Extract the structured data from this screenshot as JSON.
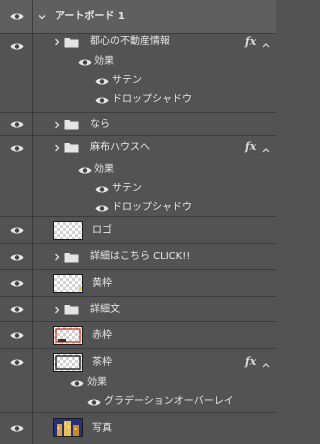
{
  "artboard": {
    "name": "アートボード 1"
  },
  "layers": {
    "toshin_group": {
      "name": "都心の不動産情報",
      "effect_header": "効果",
      "effects": [
        "サテン",
        "ドロップシャドウ"
      ]
    },
    "nara_group": {
      "name": "なら"
    },
    "azabu_group": {
      "name": "麻布ハウスへ",
      "effect_header": "効果",
      "effects": [
        "サテン",
        "ドロップシャドウ"
      ]
    },
    "logo_layer": {
      "name": "ロゴ"
    },
    "details_click_group": {
      "name": "詳細はこちら CLICK!!"
    },
    "yellow_frame_layer": {
      "name": "黄枠"
    },
    "details_text_group": {
      "name": "詳細文"
    },
    "red_frame_layer": {
      "name": "赤枠"
    },
    "brown_frame_layer": {
      "name": "茶枠",
      "effect_header": "効果",
      "effects": [
        "グラデーションオーバーレイ"
      ]
    },
    "photo_layer": {
      "name": "写真"
    }
  },
  "fx_badge": "fx",
  "colors": {
    "panel_bg": "#535353",
    "row_divider": "#3c3c3c",
    "text": "#e8e8e8",
    "yellow_frame": "#f0d000",
    "red_frame": "#cc2a1a"
  }
}
